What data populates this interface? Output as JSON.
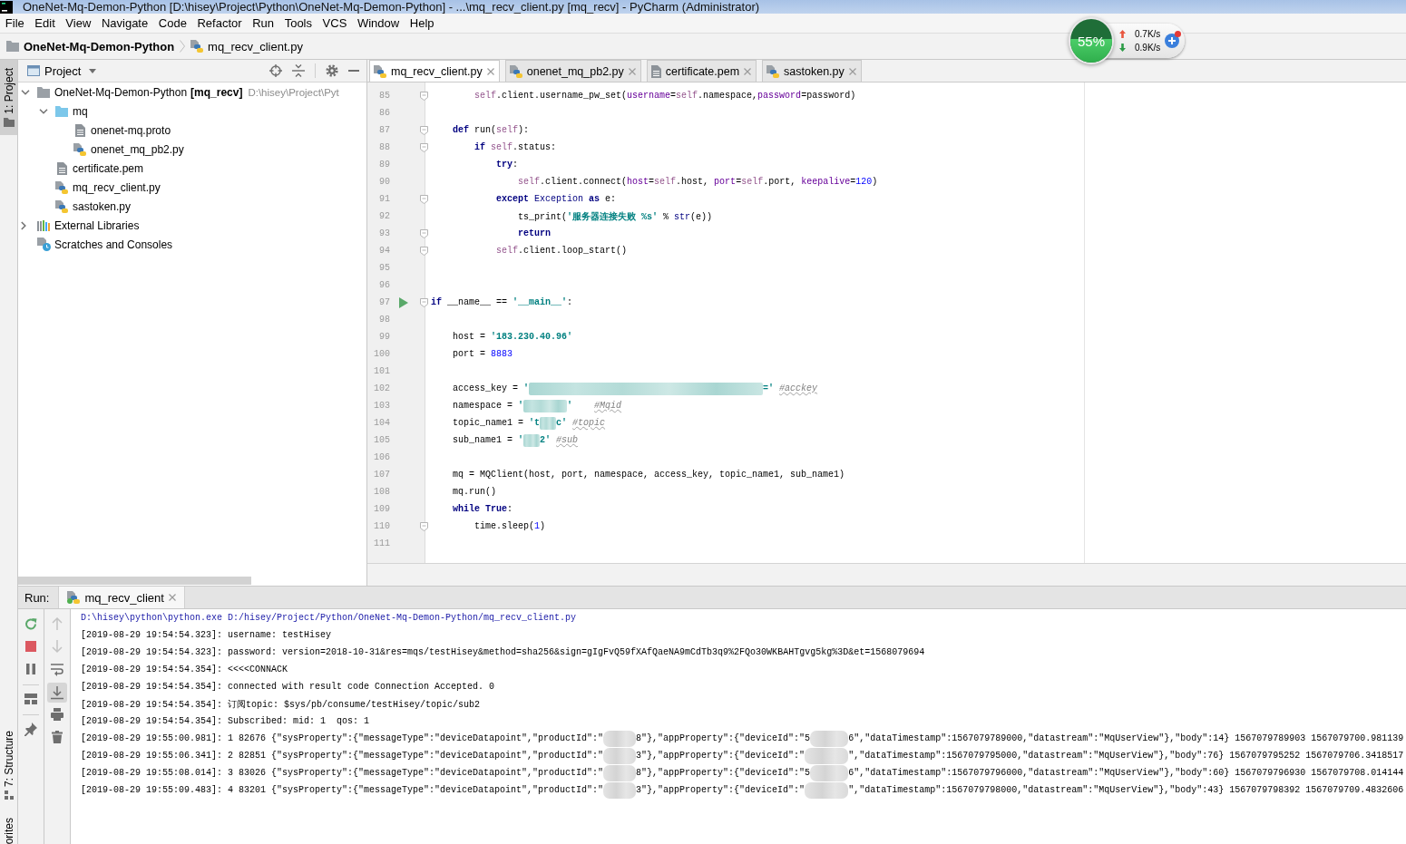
{
  "window": {
    "title": "OneNet-Mq-Demon-Python [D:\\hisey\\Project\\Python\\OneNet-Mq-Demon-Python] - ...\\mq_recv_client.py [mq_recv] - PyCharm (Administrator)"
  },
  "menu": [
    "File",
    "Edit",
    "View",
    "Navigate",
    "Code",
    "Refactor",
    "Run",
    "Tools",
    "VCS",
    "Window",
    "Help"
  ],
  "breadcrumbs": [
    {
      "label": "OneNet-Mq-Demon-Python",
      "kind": "project"
    },
    {
      "label": "mq_recv_client.py",
      "kind": "python"
    }
  ],
  "net_monitor": {
    "usage": "55%",
    "level": 0.55,
    "upload": "0.7K/s",
    "download": "0.9K/s",
    "alert": true
  },
  "tool_strip": {
    "top": [
      {
        "label": "1: Project",
        "selected": true,
        "kind": "project"
      }
    ],
    "bottom": [
      {
        "label": "7: Structure",
        "selected": false,
        "kind": "structure"
      },
      {
        "label": "orites",
        "selected": false,
        "kind": "favorites"
      }
    ]
  },
  "project_panel": {
    "title": "Project",
    "tree": [
      {
        "kind": "project",
        "label": "OneNet-Mq-Demon-Python",
        "module": "[mq_recv]",
        "path": "D:\\hisey\\Project\\Pyt",
        "expanded": true,
        "children": [
          {
            "kind": "folder",
            "label": "mq",
            "expanded": true,
            "children": [
              {
                "kind": "text",
                "label": "onenet-mq.proto"
              },
              {
                "kind": "python",
                "label": "onenet_mq_pb2.py"
              }
            ]
          },
          {
            "kind": "text",
            "label": "certificate.pem"
          },
          {
            "kind": "python",
            "label": "mq_recv_client.py"
          },
          {
            "kind": "python",
            "label": "sastoken.py"
          }
        ]
      },
      {
        "kind": "libraries",
        "label": "External Libraries",
        "expanded": false
      },
      {
        "kind": "scratches",
        "label": "Scratches and Consoles"
      }
    ]
  },
  "editor": {
    "tabs": [
      {
        "label": "mq_recv_client.py",
        "kind": "python",
        "selected": true
      },
      {
        "label": "onenet_mq_pb2.py",
        "kind": "python",
        "selected": false
      },
      {
        "label": "certificate.pem",
        "kind": "text",
        "selected": false
      },
      {
        "label": "sastoken.py",
        "kind": "python",
        "selected": false
      }
    ],
    "lines": [
      {
        "number": "85",
        "fold": true,
        "runnable": false,
        "tokens": [
          {
            "kind": "self",
            "text": "        self"
          },
          {
            "kind": "plain",
            "text": ".client.username_pw_set("
          },
          {
            "kind": "param",
            "text": "username"
          },
          {
            "kind": "plain",
            "text": "="
          },
          {
            "kind": "self",
            "text": "self"
          },
          {
            "kind": "plain",
            "text": ".namespace,"
          },
          {
            "kind": "param",
            "text": "password"
          },
          {
            "kind": "plain",
            "text": "=password)"
          }
        ]
      },
      {
        "number": "86",
        "fold": false,
        "runnable": false
      },
      {
        "number": "87",
        "fold": true,
        "runnable": false,
        "tokens": [
          {
            "kind": "keyword",
            "text": "    def"
          },
          {
            "kind": "plain",
            "text": " run("
          },
          {
            "kind": "self",
            "text": "self"
          },
          {
            "kind": "plain",
            "text": "):"
          }
        ]
      },
      {
        "number": "88",
        "fold": true,
        "runnable": false,
        "tokens": [
          {
            "kind": "keyword",
            "text": "        if "
          },
          {
            "kind": "self",
            "text": "self"
          },
          {
            "kind": "plain",
            "text": ".status:"
          }
        ]
      },
      {
        "number": "89",
        "fold": false,
        "runnable": false,
        "tokens": [
          {
            "kind": "keyword",
            "text": "            try"
          },
          {
            "kind": "plain",
            "text": ":"
          }
        ]
      },
      {
        "number": "90",
        "fold": false,
        "runnable": false,
        "tokens": [
          {
            "kind": "self",
            "text": "                self"
          },
          {
            "kind": "plain",
            "text": ".client.connect("
          },
          {
            "kind": "param",
            "text": "host"
          },
          {
            "kind": "plain",
            "text": "="
          },
          {
            "kind": "self",
            "text": "self"
          },
          {
            "kind": "plain",
            "text": ".host, "
          },
          {
            "kind": "param",
            "text": "port"
          },
          {
            "kind": "plain",
            "text": "="
          },
          {
            "kind": "self",
            "text": "self"
          },
          {
            "kind": "plain",
            "text": ".port, "
          },
          {
            "kind": "param",
            "text": "keepalive"
          },
          {
            "kind": "plain",
            "text": "="
          },
          {
            "kind": "number",
            "text": "120"
          },
          {
            "kind": "plain",
            "text": ")"
          }
        ]
      },
      {
        "number": "91",
        "fold": true,
        "runnable": false,
        "tokens": [
          {
            "kind": "keyword",
            "text": "            except "
          },
          {
            "kind": "builtin",
            "text": "Exception "
          },
          {
            "kind": "keyword",
            "text": "as"
          },
          {
            "kind": "plain",
            "text": " e:"
          }
        ]
      },
      {
        "number": "92",
        "fold": false,
        "runnable": false,
        "tokens": [
          {
            "kind": "plain",
            "text": "                ts_print("
          },
          {
            "kind": "string",
            "text": "'服务器连接失败 %s'"
          },
          {
            "kind": "plain",
            "text": " % "
          },
          {
            "kind": "builtin",
            "text": "str"
          },
          {
            "kind": "plain",
            "text": "(e))"
          }
        ]
      },
      {
        "number": "93",
        "fold": true,
        "runnable": false,
        "tokens": [
          {
            "kind": "keyword",
            "text": "                return"
          }
        ]
      },
      {
        "number": "94",
        "fold": true,
        "runnable": false,
        "tokens": [
          {
            "kind": "self",
            "text": "            self"
          },
          {
            "kind": "plain",
            "text": ".client.loop_start()"
          }
        ]
      },
      {
        "number": "95",
        "fold": false,
        "runnable": false
      },
      {
        "number": "96",
        "fold": false,
        "runnable": false
      },
      {
        "number": "97",
        "fold": true,
        "runnable": true,
        "tokens": [
          {
            "kind": "keyword",
            "text": "if"
          },
          {
            "kind": "plain",
            "text": " __name__ == "
          },
          {
            "kind": "string",
            "text": "'__main__'"
          },
          {
            "kind": "plain",
            "text": ":"
          }
        ]
      },
      {
        "number": "98",
        "fold": false,
        "runnable": false
      },
      {
        "number": "99",
        "fold": false,
        "runnable": false,
        "tokens": [
          {
            "kind": "plain",
            "text": "    host = "
          },
          {
            "kind": "string",
            "text": "'183.230.40.96'"
          }
        ]
      },
      {
        "number": "100",
        "fold": false,
        "runnable": false,
        "tokens": [
          {
            "kind": "plain",
            "text": "    port = "
          },
          {
            "kind": "number",
            "text": "8883"
          }
        ]
      },
      {
        "number": "101",
        "fold": false,
        "runnable": false
      },
      {
        "number": "102",
        "fold": false,
        "runnable": false,
        "tokens": [
          {
            "kind": "plain",
            "text": "    access_key = "
          },
          {
            "kind": "string",
            "text": "'"
          },
          {
            "kind": "blur-wide"
          },
          {
            "kind": "string",
            "text": "=' "
          },
          {
            "kind": "comment",
            "text": "#acckey"
          }
        ]
      },
      {
        "number": "103",
        "fold": false,
        "runnable": false,
        "tokens": [
          {
            "kind": "plain",
            "text": "    namespace = "
          },
          {
            "kind": "string",
            "text": "'"
          },
          {
            "kind": "blur-long"
          },
          {
            "kind": "string",
            "text": "'    "
          },
          {
            "kind": "comment",
            "text": "#Mqid"
          }
        ]
      },
      {
        "number": "104",
        "fold": false,
        "runnable": false,
        "tokens": [
          {
            "kind": "plain",
            "text": "    topic_name1 = "
          },
          {
            "kind": "string",
            "text": "'t"
          },
          {
            "kind": "blur-tiny"
          },
          {
            "kind": "string",
            "text": "c' "
          },
          {
            "kind": "comment",
            "text": "#topic"
          }
        ]
      },
      {
        "number": "105",
        "fold": false,
        "runnable": false,
        "tokens": [
          {
            "kind": "plain",
            "text": "    sub_name1 = "
          },
          {
            "kind": "string",
            "text": "'"
          },
          {
            "kind": "blur-tiny"
          },
          {
            "kind": "string",
            "text": "2' "
          },
          {
            "kind": "comment",
            "text": "#sub"
          }
        ]
      },
      {
        "number": "106",
        "fold": false,
        "runnable": false
      },
      {
        "number": "107",
        "fold": false,
        "runnable": false,
        "tokens": [
          {
            "kind": "plain",
            "text": "    mq = MQClient(host, port, namespace, access_key, topic_name1, sub_name1)"
          }
        ]
      },
      {
        "number": "108",
        "fold": false,
        "runnable": false,
        "tokens": [
          {
            "kind": "plain",
            "text": "    mq.run()"
          }
        ]
      },
      {
        "number": "109",
        "fold": false,
        "runnable": false,
        "tokens": [
          {
            "kind": "keyword",
            "text": "    while "
          },
          {
            "kind": "keyword",
            "text": "True"
          },
          {
            "kind": "plain",
            "text": ":"
          }
        ]
      },
      {
        "number": "110",
        "fold": true,
        "runnable": false,
        "tokens": [
          {
            "kind": "plain",
            "text": "        time.sleep("
          },
          {
            "kind": "number",
            "text": "1"
          },
          {
            "kind": "plain",
            "text": ")"
          }
        ]
      },
      {
        "number": "111",
        "fold": false,
        "runnable": false
      }
    ]
  },
  "run_panel": {
    "label": "Run:",
    "tabs": [
      {
        "label": "mq_recv_client",
        "selected": true
      }
    ],
    "toolbars": [
      {
        "buttons": [
          {
            "kind": "rerun",
            "disabled": false
          },
          {
            "kind": "stop",
            "disabled": false
          },
          {
            "kind": "pause",
            "disabled": false
          },
          {
            "kind": "separator"
          },
          {
            "kind": "layout",
            "disabled": false
          },
          {
            "kind": "separator"
          },
          {
            "kind": "pin",
            "disabled": false
          }
        ]
      },
      {
        "buttons": [
          {
            "kind": "up",
            "disabled": true
          },
          {
            "kind": "down",
            "disabled": true
          },
          {
            "kind": "wrap",
            "disabled": false,
            "on": false
          },
          {
            "kind": "autoscroll",
            "disabled": false,
            "on": true
          },
          {
            "kind": "print",
            "disabled": false
          },
          {
            "kind": "trash",
            "disabled": false
          }
        ]
      }
    ],
    "console": [
      {
        "kind": "command",
        "parts": [
          {
            "kind": "text",
            "text": "D:\\hisey\\python\\python.exe D:/hisey/Project/Python/OneNet-Mq-Demon-Python/mq_recv_client.py"
          }
        ]
      },
      {
        "kind": "output",
        "parts": [
          {
            "kind": "text",
            "text": "[2019-08-29 19:54:54.323]: username: testHisey"
          }
        ]
      },
      {
        "kind": "output",
        "parts": [
          {
            "kind": "text",
            "text": "[2019-08-29 19:54:54.323]: password: version=2018-10-31&res=mqs/testHisey&method=sha256&sign=gIgFvQ59fXAfQaeNA9mCdTb3q9%2FQo30WKBAHTgvg5kg%3D&et=1568079694"
          }
        ]
      },
      {
        "kind": "output",
        "parts": [
          {
            "kind": "text",
            "text": "[2019-08-29 19:54:54.354]: <<<<CONNACK"
          }
        ]
      },
      {
        "kind": "output",
        "parts": [
          {
            "kind": "text",
            "text": "[2019-08-29 19:54:54.354]: connected with result code Connection Accepted. 0"
          }
        ]
      },
      {
        "kind": "output",
        "parts": [
          {
            "kind": "text",
            "text": "[2019-08-29 19:54:54.354]: 订阅topic: $sys/pb/consume/testHisey/topic/sub2"
          }
        ]
      },
      {
        "kind": "output",
        "parts": [
          {
            "kind": "text",
            "text": "[2019-08-29 19:54:54.354]: Subscribed: mid: 1  qos: 1"
          }
        ]
      },
      {
        "kind": "output",
        "parts": [
          {
            "kind": "text",
            "text": "[2019-08-29 19:55:00.981]: 1 82676 {\"sysProperty\":{\"messageType\":\"deviceDatapoint\",\"productId\":\""
          },
          {
            "kind": "blur-short"
          },
          {
            "kind": "text",
            "text": "8\"},\"appProperty\":{\"deviceId\":\"5"
          },
          {
            "kind": "blur-medium"
          },
          {
            "kind": "text",
            "text": "6\",\"dataTimestamp\":1567079789000,\"datastream\":\"MqUserView\"},\"body\":14} 1567079789903 1567079700.981139"
          }
        ]
      },
      {
        "kind": "output",
        "parts": [
          {
            "kind": "text",
            "text": "[2019-08-29 19:55:06.341]: 2 82851 {\"sysProperty\":{\"messageType\":\"deviceDatapoint\",\"productId\":\""
          },
          {
            "kind": "blur-short"
          },
          {
            "kind": "text",
            "text": "3\"},\"appProperty\":{\"deviceId\":\""
          },
          {
            "kind": "blur-long"
          },
          {
            "kind": "text",
            "text": "\",\"dataTimestamp\":1567079795000,\"datastream\":\"MqUserView\"},\"body\":76} 1567079795252 1567079706.3418517"
          }
        ]
      },
      {
        "kind": "output",
        "parts": [
          {
            "kind": "text",
            "text": "[2019-08-29 19:55:08.014]: 3 83026 {\"sysProperty\":{\"messageType\":\"deviceDatapoint\",\"productId\":\""
          },
          {
            "kind": "blur-short"
          },
          {
            "kind": "text",
            "text": "8\"},\"appProperty\":{\"deviceId\":\"5"
          },
          {
            "kind": "blur-medium"
          },
          {
            "kind": "text",
            "text": "6\",\"dataTimestamp\":1567079796000,\"datastream\":\"MqUserView\"},\"body\":60} 1567079796930 1567079708.014144"
          }
        ]
      },
      {
        "kind": "output",
        "parts": [
          {
            "kind": "text",
            "text": "[2019-08-29 19:55:09.483]: 4 83201 {\"sysProperty\":{\"messageType\":\"deviceDatapoint\",\"productId\":\""
          },
          {
            "kind": "blur-short"
          },
          {
            "kind": "text",
            "text": "3\"},\"appProperty\":{\"deviceId\":\""
          },
          {
            "kind": "blur-long"
          },
          {
            "kind": "text",
            "text": "\",\"dataTimestamp\":1567079798000,\"datastream\":\"MqUserView\"},\"body\":43} 1567079798392 1567079709.4832606"
          }
        ]
      }
    ]
  }
}
